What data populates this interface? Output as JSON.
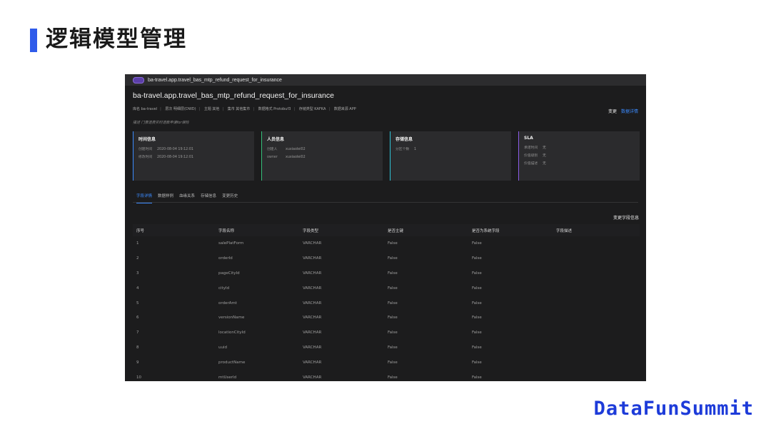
{
  "slide": {
    "title": "逻辑模型管理",
    "brand": "DataFunSummit"
  },
  "window": {
    "tab_title": "ba-travel.app.travel_bas_mtp_refund_request_for_insurance",
    "page_name": "ba-travel.app.travel_bas_mtp_refund_request_for_insurance",
    "meta": [
      "库名 ba-travel",
      "层次 明细层(DWD)",
      "主题 其他",
      "集市 其他集市",
      "数据格式 Protobuf3",
      "存储类型 KAFKA",
      "数据来源 APP"
    ],
    "actions": {
      "change": "变更",
      "detail": "数据详情"
    },
    "description": "描述 门票退费实时退款申请for保险"
  },
  "cards": [
    {
      "title": "时间信息",
      "color": "#3b8bff",
      "rows": [
        {
          "k": "创建时间",
          "v": "2020-08-04 19:12:01"
        },
        {
          "k": "修改时间",
          "v": "2020-08-04 19:12:01"
        }
      ]
    },
    {
      "title": "人员信息",
      "color": "#36c07a",
      "rows": [
        {
          "k": "创建人",
          "v": "xuxiaolei02"
        },
        {
          "k": "owner",
          "v": "xuxiaolei02"
        }
      ]
    },
    {
      "title": "存储信息",
      "color": "#2ec4d6",
      "rows": [
        {
          "k": "分区个数",
          "v": "1"
        }
      ]
    },
    {
      "title": "SLA",
      "color": "#8a5ce6",
      "rows": [
        {
          "k": "承诺时间",
          "v": "无"
        },
        {
          "k": "价值级别",
          "v": "无"
        },
        {
          "k": "价值描述",
          "v": "无"
        }
      ]
    }
  ],
  "tabs": [
    "字段详情",
    "数据样例",
    "血缘关系",
    "存储信息",
    "变更历史"
  ],
  "change_fields": "变更字段信息",
  "table": {
    "headers": [
      "序号",
      "字段名称",
      "字段类型",
      "是否主键",
      "是否为系统字段",
      "字段描述"
    ],
    "rows": [
      [
        "1",
        "salePlatForm",
        "VARCHAR",
        "False",
        "False",
        ""
      ],
      [
        "2",
        "orderId",
        "VARCHAR",
        "False",
        "False",
        ""
      ],
      [
        "3",
        "pageCityId",
        "VARCHAR",
        "False",
        "False",
        ""
      ],
      [
        "4",
        "cityId",
        "VARCHAR",
        "False",
        "False",
        ""
      ],
      [
        "5",
        "orderAmt",
        "VARCHAR",
        "False",
        "False",
        ""
      ],
      [
        "6",
        "versionName",
        "VARCHAR",
        "False",
        "False",
        ""
      ],
      [
        "7",
        "locationCityId",
        "VARCHAR",
        "False",
        "False",
        ""
      ],
      [
        "8",
        "uuid",
        "VARCHAR",
        "False",
        "False",
        ""
      ],
      [
        "9",
        "productName",
        "VARCHAR",
        "False",
        "False",
        ""
      ],
      [
        "10",
        "mtUserId",
        "VARCHAR",
        "False",
        "False",
        ""
      ]
    ]
  }
}
